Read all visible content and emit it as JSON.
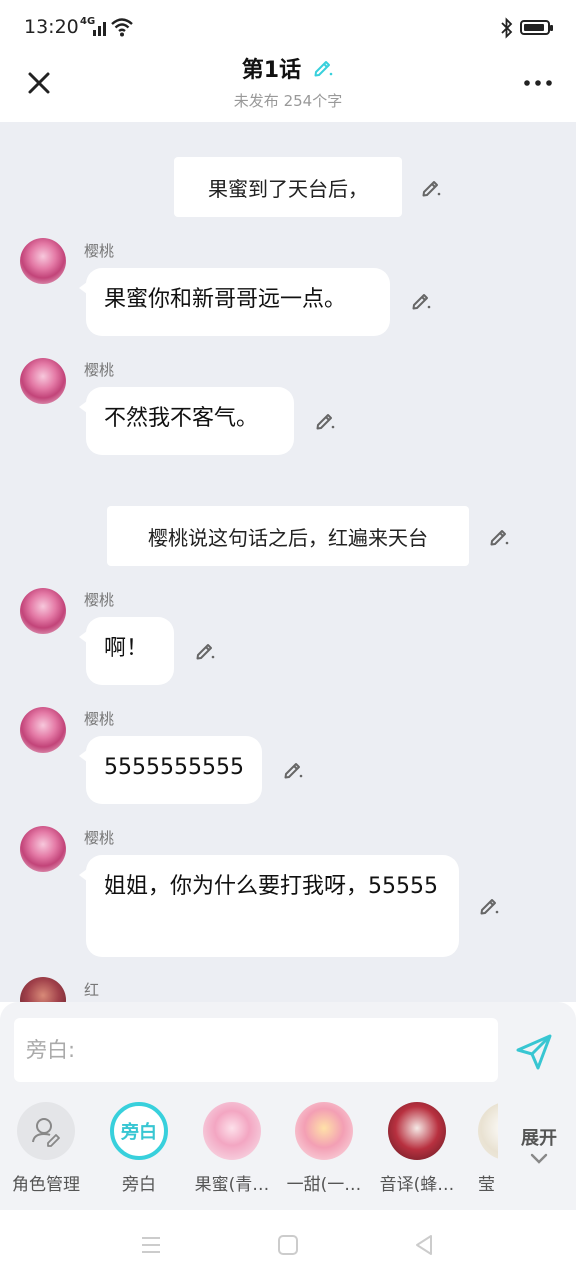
{
  "status": {
    "time": "13:20",
    "network": "4G"
  },
  "header": {
    "title": "第1话",
    "subtitle": "未发布 254个字"
  },
  "messages": [
    {
      "type": "narration",
      "text": "果蜜到了天台后，"
    },
    {
      "type": "chat",
      "name": "樱桃",
      "text": "果蜜你和新哥哥远一点。"
    },
    {
      "type": "chat",
      "name": "樱桃",
      "text": "不然我不客气。"
    },
    {
      "type": "narration",
      "text": "樱桃说这句话之后，红遍来天台"
    },
    {
      "type": "chat",
      "name": "樱桃",
      "text": "啊！"
    },
    {
      "type": "chat",
      "name": "樱桃",
      "text": "5555555555"
    },
    {
      "type": "chat",
      "name": "樱桃",
      "text": "姐姐，你为什么要打我呀，55555"
    },
    {
      "type": "chat",
      "name": "红",
      "text": ""
    }
  ],
  "composer": {
    "placeholder": "旁白:"
  },
  "roles": [
    {
      "label": "角色管理",
      "icon": "role-manage-icon"
    },
    {
      "label": "旁白",
      "badge": "旁白"
    },
    {
      "label": "果蜜(青…"
    },
    {
      "label": "一甜(一…"
    },
    {
      "label": "音译(蜂…"
    },
    {
      "label": "莹"
    }
  ],
  "expand_label": "展开",
  "colors": {
    "accent": "#38d0dc",
    "chat_bg": "#eceef3",
    "composer_bg": "#f2f3f6"
  }
}
